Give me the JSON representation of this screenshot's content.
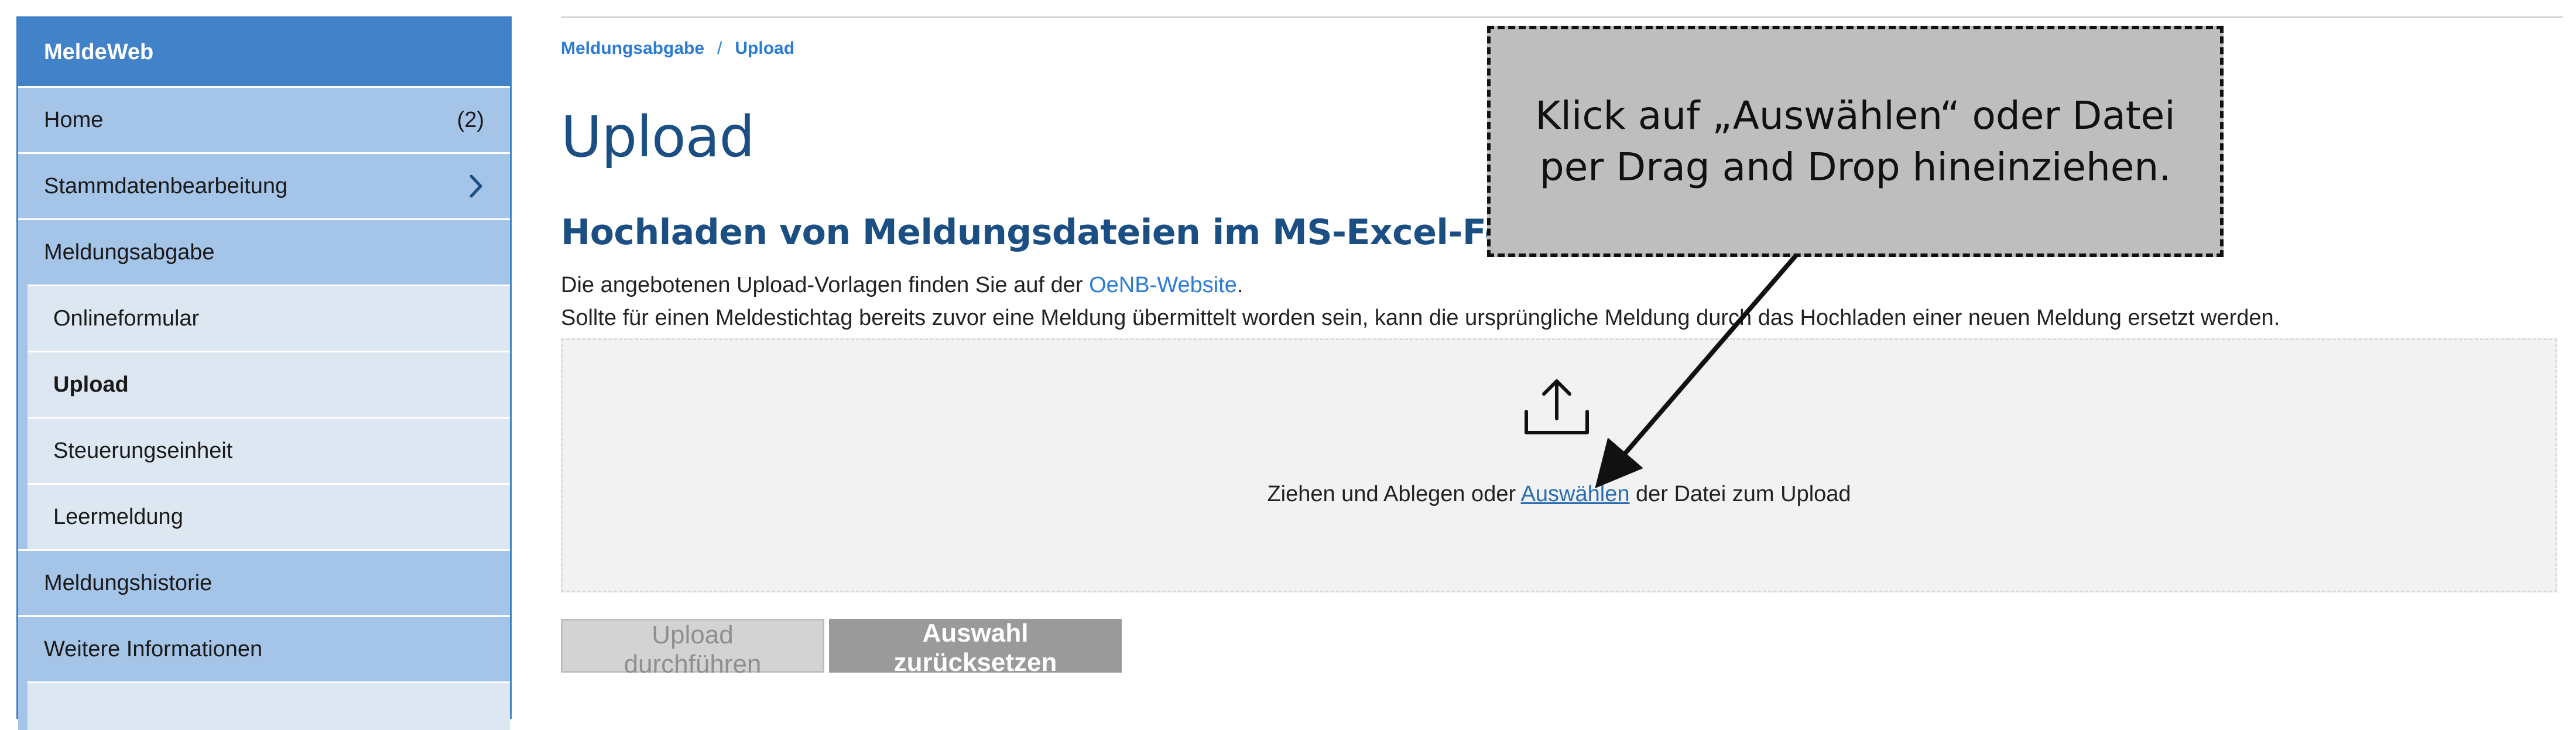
{
  "sidebar": {
    "header": "MeldeWeb",
    "home": {
      "label": "Home",
      "count": "(2)"
    },
    "stammdaten": {
      "label": "Stammdatenbearbeitung"
    },
    "meldungsabgabe": {
      "label": "Meldungsabgabe"
    },
    "subitems": [
      {
        "label": "Onlineformular"
      },
      {
        "label": "Upload"
      },
      {
        "label": "Steuerungseinheit"
      },
      {
        "label": "Leermeldung"
      }
    ],
    "meldungshistorie": {
      "label": "Meldungshistorie"
    },
    "weitere": {
      "label": "Weitere Informationen"
    }
  },
  "breadcrumb": {
    "parent": "Meldungsabgabe",
    "separator": "/",
    "current": "Upload"
  },
  "page": {
    "title": "Upload",
    "section_title": "Hochladen von Meldungsdateien im MS-Excel-Format",
    "desc_1_prefix": "Die angebotenen Upload-Vorlagen finden Sie auf der ",
    "desc_1_link": "OeNB-Website",
    "desc_1_suffix": ".",
    "desc_2": "Sollte für einen Meldestichtag bereits zuvor eine Meldung übermittelt worden sein, kann die ursprüngliche Meldung durch das Hochladen einer neuen Meldung ersetzt werden."
  },
  "dropzone": {
    "icon": "upload-icon",
    "text_prefix": "Ziehen und Ablegen oder ",
    "link": "Auswählen",
    "text_suffix": " der Datei zum Upload"
  },
  "buttons": {
    "upload": "Upload durchführen",
    "reset": "Auswahl zurücksetzen"
  },
  "callout": {
    "text": "Klick auf „Auswählen“ oder Datei per Drag and Drop hineinziehen."
  },
  "colors": {
    "brand": "#4182c8",
    "sidebar_item": "#a4c4e8",
    "sidebar_sub": "#dde7f1",
    "link": "#2a7bd4",
    "heading": "#1b4f84"
  }
}
